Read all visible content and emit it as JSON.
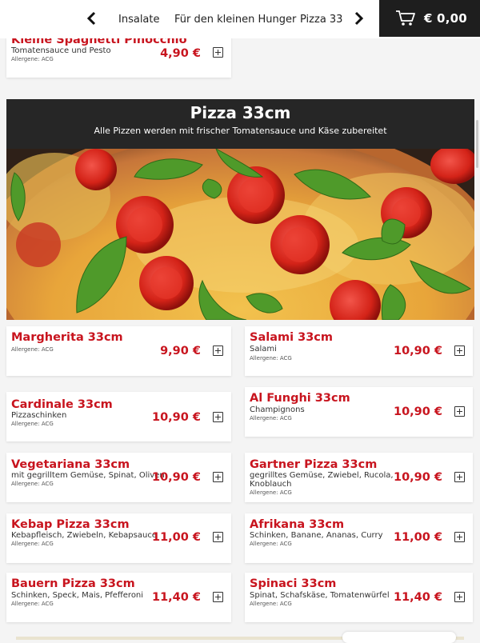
{
  "nav": {
    "categories": [
      "Insalate",
      "Für den kleinen Hunger",
      "Pizza 33"
    ],
    "cart_total": "€ 0,00"
  },
  "top_item": {
    "name": "Kleine Spaghetti Pinocchio",
    "description": "Tomatensauce und Pesto",
    "allergens": "Allergene: ACG",
    "price": "4,90 €"
  },
  "section": {
    "title": "Pizza 33cm",
    "subtitle": "Alle Pizzen werden mit frischer Tomatensauce und Käse zubereitet"
  },
  "items": [
    {
      "name": "Margherita 33cm",
      "description": "",
      "allergens": "Allergene: ACG",
      "price": "9,90 €"
    },
    {
      "name": "Salami 33cm",
      "description": "Salami",
      "allergens": "Allergene: ACG",
      "price": "10,90 €"
    },
    {
      "name": "Cardinale 33cm",
      "description": "Pizzaschinken",
      "allergens": "Allergene: ACG",
      "price": "10,90 €"
    },
    {
      "name": "Al Funghi 33cm",
      "description": "Champignons",
      "allergens": "Allergene: ACG",
      "price": "10,90 €"
    },
    {
      "name": "Vegetariana 33cm",
      "description": "mit gegrilltem Gemüse, Spinat, Oliven",
      "allergens": "Allergene: ACG",
      "price": "10,90 €"
    },
    {
      "name": "Gartner Pizza 33cm",
      "description": "gegrilltes Gemüse, Zwiebel, Rucola, Knoblauch",
      "allergens": "Allergene: ACG",
      "price": "10,90 €"
    },
    {
      "name": "Kebap Pizza 33cm",
      "description": "Kebapfleisch, Zwiebeln, Kebapsauce",
      "allergens": "Allergene: ACG",
      "price": "11,00 €"
    },
    {
      "name": "Afrikana 33cm",
      "description": "Schinken, Banane, Ananas, Curry",
      "allergens": "Allergene: ACG",
      "price": "11,00 €"
    },
    {
      "name": "Bauern Pizza 33cm",
      "description": "Schinken, Speck, Mais, Pfefferoni",
      "allergens": "Allergene: ACG",
      "price": "11,40 €"
    },
    {
      "name": "Spinaci 33cm",
      "description": "Spinat, Schafskäse, Tomatenwürfel",
      "allergens": "Allergene: ACG",
      "price": "11,40 €"
    }
  ],
  "icons": {
    "prev": "chevron-left-icon",
    "next": "chevron-right-icon",
    "cart": "shopping-cart-icon",
    "add": "plus-square-icon"
  },
  "colors": {
    "accent_red": "#c8141e",
    "header_dark": "#262626",
    "cart_bg": "#1e1e1e"
  }
}
